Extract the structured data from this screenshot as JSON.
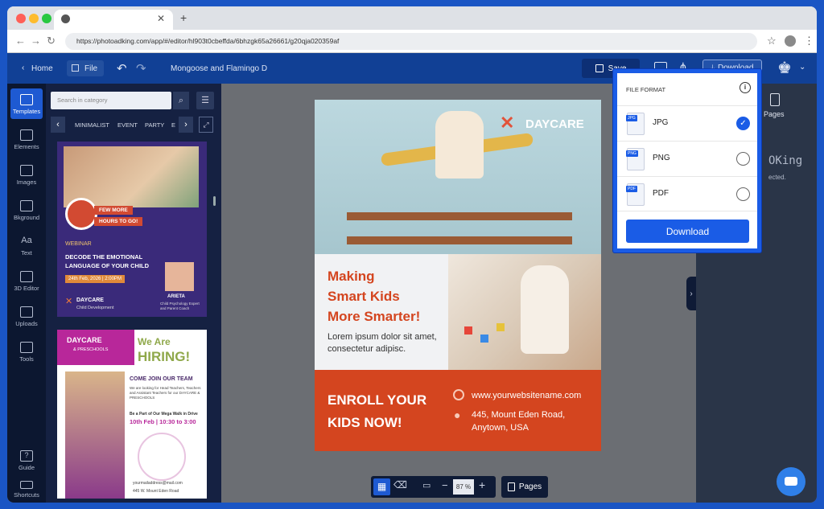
{
  "browser": {
    "tab_title": "",
    "url": "https://photoadking.com/app/#/editor/hl903t0cbeffda/6bhzgk65a26661/g20qja020359af"
  },
  "appbar": {
    "home_label": "Home",
    "file_label": "File",
    "doc_title": "Mongoose and Flamingo D",
    "save_label": "Save",
    "download_label": "Download"
  },
  "rail": {
    "items": [
      {
        "label": "Templates"
      },
      {
        "label": "Elements"
      },
      {
        "label": "Images"
      },
      {
        "label": "Bkground"
      },
      {
        "label": "Text"
      },
      {
        "label": "3D Editor"
      },
      {
        "label": "Uploads"
      },
      {
        "label": "Tools"
      }
    ],
    "guide_label": "Guide",
    "shortcuts_label": "Shortcuts"
  },
  "panel": {
    "search_placeholder": "Search in category",
    "categories": [
      "MINIMALIST",
      "EVENT",
      "PARTY",
      "E"
    ],
    "card1": {
      "badge1": "FEW MORE",
      "badge2": "HOURS TO GO!",
      "tag": "WEBINAR",
      "title": "DECODE THE EMOTIONAL LANGUAGE OF YOUR CHILD",
      "date": "24th Feb, 2026 | 2:00PM",
      "brand": "DAYCARE",
      "brand_sub": "Child Development",
      "speaker": "ARIETA",
      "speaker_sub": "Child Psychology Expert and Parent Coach"
    },
    "card2": {
      "brand": "DAYCARE",
      "brand_sub": "& PRESCHOOLS",
      "headline1": "We Are",
      "headline2": "HIRING!",
      "join": "COME JOIN OUR TEAM",
      "body": "We are looking for Head Teachers, Teachers and Assistant Teachers for our DAYCARE & PRESCHOOLS",
      "walkin": "Be a Part of Our Mega Walk in Drive",
      "walkin_date": "10th Feb | 10:30 to 3:00",
      "email": "yourmailaddress@mail.com",
      "address": "445 W. Mount Eden Road"
    }
  },
  "poster": {
    "logo_text": "DAYCARE",
    "headline": [
      "Making",
      "Smart Kids",
      "More Smarter!"
    ],
    "body": "Lorem ipsum dolor sit amet, consectetur adipisc.",
    "cta": [
      "ENROLL YOUR",
      "KIDS NOW!"
    ],
    "website": "www.yourwebsitename.com",
    "address": [
      "445, Mount Eden Road,",
      "Anytown, USA"
    ]
  },
  "right": {
    "pages_label": "Pages",
    "partial1": "OKing",
    "partial2": "ected."
  },
  "popup": {
    "title": "FILE FORMAT",
    "formats": [
      {
        "label": "JPG",
        "tag": "JPG",
        "selected": true
      },
      {
        "label": "PNG",
        "tag": "PNG",
        "selected": false
      },
      {
        "label": "PDF",
        "tag": "PDF",
        "selected": false
      }
    ],
    "download_label": "Download"
  },
  "bottom": {
    "zoom": "87 %",
    "pages_label": "Pages"
  },
  "colors": {
    "accent": "#1a5ce6",
    "poster_orange": "#d4451f",
    "appbar": "#114095"
  }
}
